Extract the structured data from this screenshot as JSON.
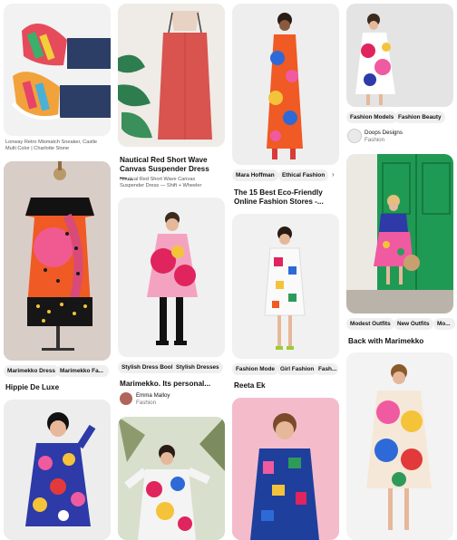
{
  "pins": [
    {
      "id": "sneakers",
      "desc": "Lonway Retro Mismatch Sneaker, Castle Multi Color | Charlotte Stone"
    },
    {
      "id": "nautical",
      "title": "Nautical Red Short Wave Canvas Suspender Dress —...",
      "desc": "Nautical Red Short Wave Canvas Suspender Dress — Shift + Wheeler"
    },
    {
      "id": "floral-long",
      "tags": [
        "Mara Hoffman",
        "Ethical Fashion"
      ],
      "title": "The 15 Best Eco-Friendly Online Fashion Stores -..."
    },
    {
      "id": "fashion-models",
      "tags": [
        "Fashion Models",
        "Fashion Beauty"
      ],
      "user": "Doops Designs",
      "category": "Fashion"
    },
    {
      "id": "hippie",
      "tags": [
        "Marimekko Dress",
        "Marimekko Fa..."
      ],
      "title": "Hippie De Luxe"
    },
    {
      "id": "marimekko-personal",
      "tags": [
        "Stylish Dress Book",
        "Stylish Dresses"
      ],
      "title": "Marimekko. Its personal...",
      "user": "Emma Malloy",
      "category": "Fashion"
    },
    {
      "id": "reeta",
      "tags": [
        "Fashion Mode",
        "Girl Fashion",
        "Fash..."
      ],
      "title": "Reeta Ek"
    },
    {
      "id": "back-marimekko",
      "tags": [
        "Modest Outfits",
        "New Outfits",
        "Mo..."
      ],
      "title": "Back with Marimekko"
    }
  ],
  "colors": {
    "pin_bg": "#efefef",
    "tag_bg": "#efefef",
    "text": "#111111",
    "muted": "#767676"
  },
  "icons": [
    "chevron-right-icon"
  ]
}
